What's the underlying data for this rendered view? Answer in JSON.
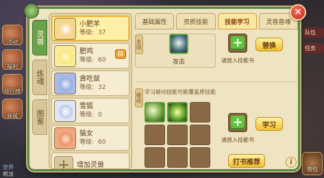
{
  "background": {
    "left_icons": [
      "活动",
      "福利",
      "排行榜",
      "商城"
    ],
    "right_tags": [
      "队伍",
      "任务"
    ],
    "chat": [
      "世界",
      "帮派"
    ],
    "bag_label": "背包"
  },
  "side_tabs": [
    "灵兽",
    "炼魂",
    "图鉴"
  ],
  "pets": [
    {
      "name": "小肥羊",
      "level_label": "等级:",
      "level": "37",
      "selected": true,
      "fight": false,
      "color": "#f0c060"
    },
    {
      "name": "肥鸡",
      "level_label": "等级:",
      "level": "60",
      "selected": false,
      "fight": true,
      "fight_label": "战",
      "color": "#f4e04a"
    },
    {
      "name": "貪吃鼠",
      "level_label": "等级:",
      "level": "32",
      "selected": false,
      "fight": false,
      "color": "#6a8ad0"
    },
    {
      "name": "雪狐",
      "level_label": "等级:",
      "level": "0",
      "selected": false,
      "fight": false,
      "color": "#c8d8f0"
    },
    {
      "name": "猫女",
      "level_label": "等级:",
      "level": "60",
      "selected": false,
      "fight": false,
      "color": "#e06a3a"
    }
  ],
  "add_pet_label": "增加灵兽",
  "tabs": [
    "基础属性",
    "资质技能",
    "技能学习",
    "灵兽兽魂"
  ],
  "active_tab": 2,
  "skill_section": {
    "tag": "主动",
    "active_skill_label": "攻击",
    "put_book_label": "请放入技能书",
    "replace_button": "替换"
  },
  "learn_section": {
    "tag": "被动",
    "title": "学习被动技能可能覆盖原技能",
    "put_book_label": "请放入技能书",
    "learn_button": "学习"
  },
  "recommend_button": "打书推荐",
  "info_glyph": "i",
  "close_glyph": "✕"
}
